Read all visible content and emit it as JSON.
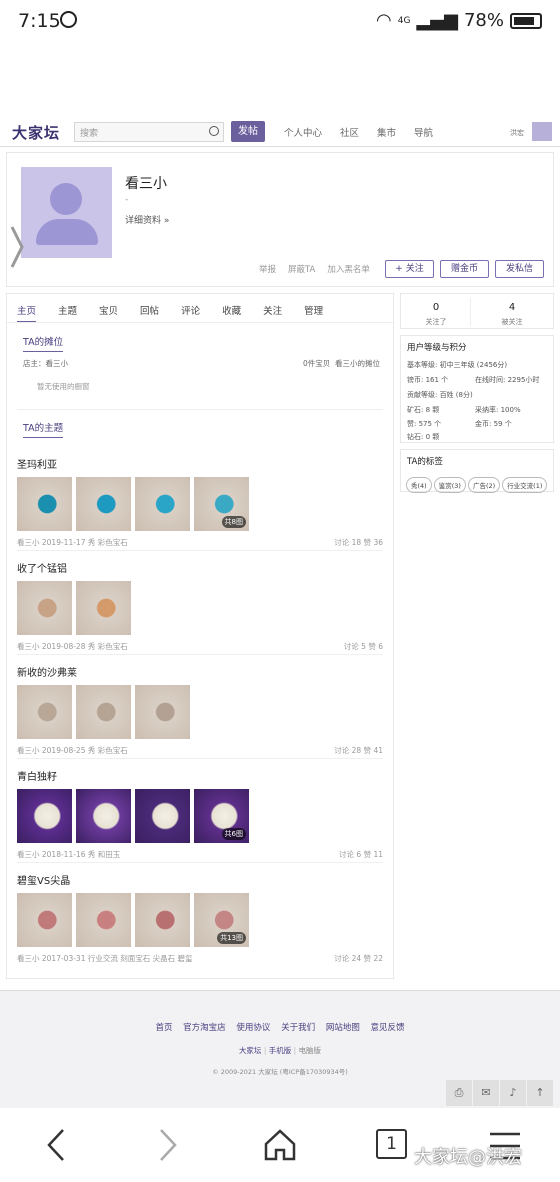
{
  "status_bar": {
    "time": "7:15",
    "signal": "4G",
    "battery": "78%"
  },
  "header": {
    "logo": "大家坛",
    "search_placeholder": "搜索",
    "post_button": "发帖",
    "nav": [
      "个人中心",
      "社区",
      "集市",
      "导航"
    ],
    "user": "洪宏"
  },
  "profile": {
    "name": "看三小",
    "subtitle": "-",
    "detail_link": "详细资料 »",
    "links": [
      "举报",
      "屏蔽TA",
      "加入黑名单"
    ],
    "buttons": [
      "+ 关注",
      "赠金币",
      "发私信"
    ]
  },
  "tabs": [
    "主页",
    "主题",
    "宝贝",
    "回帖",
    "评论",
    "收藏",
    "关注",
    "管理"
  ],
  "stall": {
    "title": "TA的摊位",
    "owner": "店主：看三小",
    "count": "0件宝贝",
    "stall_link": "看三小的摊位",
    "empty": "暂无使用的橱窗"
  },
  "threads_title": "TA的主题",
  "threads": [
    {
      "title": "圣玛利亚",
      "meta": "看三小 2019-11-17 秀   彩色宝石",
      "stats": "讨论 18 赞 36",
      "count_badge": "共8图",
      "colors": [
        "#1a8fb0",
        "#1e9ac0",
        "#2aa5c8",
        "#3aa9c4"
      ]
    },
    {
      "title": "收了个锰铝",
      "meta": "看三小 2019-08-28 秀   彩色宝石",
      "stats": "讨论 5 赞 6",
      "count_badge": "",
      "colors": [
        "#c8a285",
        "#d49a6a"
      ]
    },
    {
      "title": "新收的沙弗莱",
      "meta": "看三小 2019-08-25 秀   彩色宝石",
      "stats": "讨论 28 赞 41",
      "count_badge": "",
      "colors": [
        "#b8a797",
        "#b5a394",
        "#b3a193"
      ]
    },
    {
      "title": "青白独籽",
      "meta": "看三小 2018-11-16 秀   和田玉",
      "stats": "讨论 6 赞 11",
      "count_badge": "共6图",
      "colors": [
        "#5b2d8e",
        "#6a3a9a",
        "#4a2a78",
        "#5e2f8a"
      ]
    },
    {
      "title": "碧玺VS尖晶",
      "meta": "看三小 2017-03-31 行业交流  刻面宝石 尖晶石 碧玺",
      "stats": "讨论 24 赞 22",
      "count_badge": "共13图",
      "colors": [
        "#c07a7a",
        "#c88080",
        "#b87070",
        "#c48585"
      ]
    }
  ],
  "follow": {
    "following_count": "0",
    "following_label": "关注了",
    "followers_count": "4",
    "followers_label": "被关注"
  },
  "level": {
    "title": "用户等级与积分",
    "basic": "基本等级: 初中三年级 (2456分)",
    "coins": "镑币:  161 个",
    "online": "在线时间:  2295小时",
    "contrib": "贡献等级: 百姓 (8分)",
    "ore": "矿石:  8 颗",
    "adopt": "采纳率:  100%",
    "likes": "赞:  575 个",
    "gold": "金币:  59 个",
    "diamond": "钻石:  0 颗"
  },
  "tags": {
    "title": "TA的标签",
    "items": [
      "秀(4)",
      "鉴赏(3)",
      "广告(2)",
      "行业交流(1)"
    ]
  },
  "footer": {
    "links": [
      "首页",
      "官方淘宝店",
      "使用协议",
      "关于我们",
      "网站地图",
      "意见反馈"
    ],
    "sub": [
      "大家坛",
      "手机版",
      "电脑版"
    ],
    "copyright": "© 2009-2021 大家坛  (粤ICP备17030934号)"
  },
  "watermark": "大家坛@洪宏"
}
